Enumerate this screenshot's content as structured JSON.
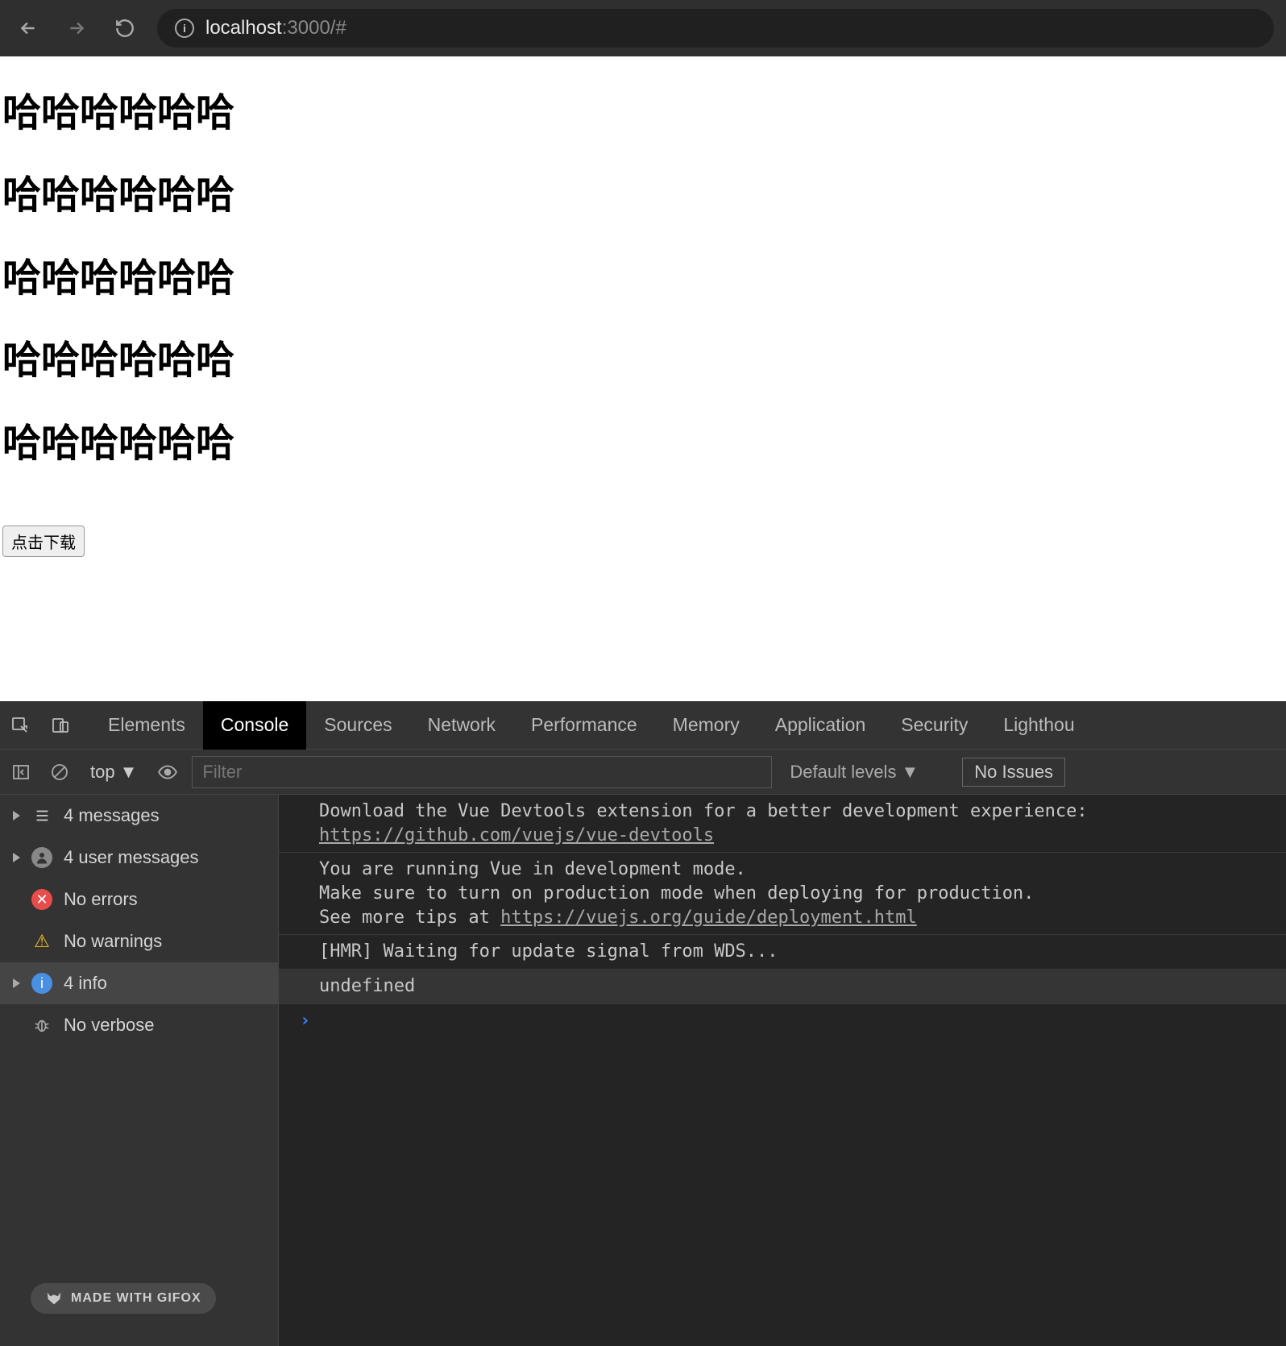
{
  "browser": {
    "url_host": "localhost",
    "url_port_path": ":3000/#"
  },
  "page": {
    "headings": [
      "哈哈哈哈哈哈",
      "哈哈哈哈哈哈",
      "哈哈哈哈哈哈",
      "哈哈哈哈哈哈",
      "哈哈哈哈哈哈"
    ],
    "download_button": "点击下载"
  },
  "devtools": {
    "tabs": [
      "Elements",
      "Console",
      "Sources",
      "Network",
      "Performance",
      "Memory",
      "Application",
      "Security",
      "Lighthou"
    ],
    "active_tab": "Console",
    "toolbar": {
      "context": "top",
      "filter_placeholder": "Filter",
      "levels_label": "Default levels",
      "issues_label": "No Issues"
    },
    "sidebar": {
      "items": [
        {
          "icon": "list",
          "label": "4 messages",
          "expandable": true
        },
        {
          "icon": "user",
          "label": "4 user messages",
          "expandable": true
        },
        {
          "icon": "error",
          "label": "No errors",
          "expandable": false
        },
        {
          "icon": "warn",
          "label": "No warnings",
          "expandable": false
        },
        {
          "icon": "info",
          "label": "4 info",
          "expandable": true,
          "selected": true
        },
        {
          "icon": "verbose",
          "label": "No verbose",
          "expandable": false
        }
      ]
    },
    "messages": [
      {
        "text": "Download the Vue Devtools extension for a better development experience: ",
        "link": "https://github.com/vuejs/vue-devtools"
      },
      {
        "text": "You are running Vue in development mode.\nMake sure to turn on production mode when deploying for production.\nSee more tips at ",
        "link": "https://vuejs.org/guide/deployment.html"
      },
      {
        "text": "[HMR] Waiting for update signal from WDS..."
      },
      {
        "text": "undefined",
        "selected": true
      }
    ],
    "prompt": "›"
  },
  "badge": {
    "label": "MADE WITH GIFOX"
  }
}
